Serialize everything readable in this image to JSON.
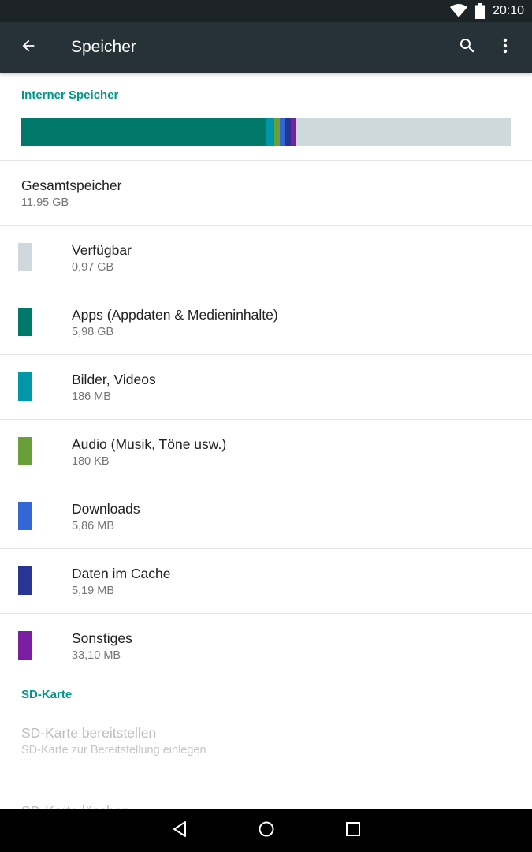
{
  "status_bar": {
    "time": "20:10",
    "icons": [
      "wifi-icon",
      "battery-icon"
    ]
  },
  "app_bar": {
    "title": "Speicher",
    "back_icon": "arrow-back-icon",
    "actions": [
      "search-icon",
      "more-vert-icon"
    ]
  },
  "internal_storage": {
    "header": "Interner Speicher",
    "usage_bar": {
      "segments": [
        {
          "name": "Apps",
          "fraction": 0.5,
          "color": "#00796b"
        },
        {
          "name": "Bilder, Videos",
          "fraction": 0.016,
          "color": "#0097a7"
        },
        {
          "name": "Audio",
          "fraction": 0.012,
          "color": "#689f38"
        },
        {
          "name": "Downloads",
          "fraction": 0.012,
          "color": "#3367d6"
        },
        {
          "name": "Daten im Cache",
          "fraction": 0.011,
          "color": "#283593"
        },
        {
          "name": "Sonstiges",
          "fraction": 0.01,
          "color": "#7b1fa2"
        }
      ],
      "free_color": "#cfd8dc"
    },
    "total": {
      "label": "Gesamtspeicher",
      "value": "11,95 GB"
    },
    "items": [
      {
        "label": "Verfügbar",
        "value": "0,97 GB",
        "color": "#cfd8dc"
      },
      {
        "label": "Apps (Appdaten & Medieninhalte)",
        "value": "5,98 GB",
        "color": "#00796b"
      },
      {
        "label": "Bilder, Videos",
        "value": "186 MB",
        "color": "#0097a7"
      },
      {
        "label": "Audio (Musik, Töne usw.)",
        "value": "180 KB",
        "color": "#689f38"
      },
      {
        "label": "Downloads",
        "value": "5,86 MB",
        "color": "#3367d6"
      },
      {
        "label": "Daten im Cache",
        "value": "5,19 MB",
        "color": "#283593"
      },
      {
        "label": "Sonstiges",
        "value": "33,10 MB",
        "color": "#7b1fa2"
      }
    ]
  },
  "sd_card": {
    "header": "SD-Karte",
    "mount": {
      "label": "SD-Karte bereitstellen",
      "sub": "SD-Karte zur Bereitstellung einlegen"
    },
    "erase": {
      "label": "SD-Karte löschen"
    }
  },
  "nav_bar": {
    "buttons": [
      "back-triangle-icon",
      "home-circle-icon",
      "recents-square-icon"
    ]
  },
  "colors": {
    "accent": "#009688",
    "app_bar": "#263238",
    "status_bar": "#1c2428"
  }
}
